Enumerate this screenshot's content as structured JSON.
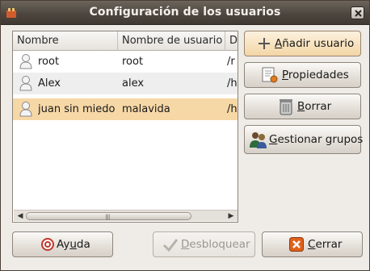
{
  "window": {
    "title": "Configuración de los usuarios",
    "app_icon": "users-admin-icon",
    "close_icon": "close-icon"
  },
  "table": {
    "columns": [
      "Nombre",
      "Nombre de usuario",
      "Di"
    ],
    "rows": [
      {
        "name": "root",
        "username": "root",
        "dir": "/r",
        "selected": false
      },
      {
        "name": "Alex",
        "username": "alex",
        "dir": "/h",
        "selected": false
      },
      {
        "name": "juan sin miedo",
        "username": "malavida",
        "dir": "/h",
        "selected": true
      }
    ],
    "row_icon": "user-icon"
  },
  "side_buttons": {
    "add": {
      "pre": "",
      "mnemonic": "A",
      "post": "ñadir usuario",
      "icon": "plus-icon"
    },
    "properties": {
      "pre": "",
      "mnemonic": "P",
      "post": "ropiedades",
      "icon": "properties-icon"
    },
    "delete": {
      "pre": "",
      "mnemonic": "B",
      "post": "orrar",
      "icon": "trash-icon"
    },
    "groups": {
      "pre": "",
      "mnemonic": "G",
      "post": "estionar grupos",
      "icon": "groups-icon"
    }
  },
  "bottom_buttons": {
    "help": {
      "pre": "Ay",
      "mnemonic": "u",
      "post": "da",
      "icon": "help-icon"
    },
    "unlock": {
      "pre": "",
      "mnemonic": "D",
      "post": "esbloquear",
      "icon": "checkmark-icon",
      "enabled": false
    },
    "close": {
      "pre": "",
      "mnemonic": "C",
      "post": "errar",
      "icon": "close-icon"
    }
  },
  "colors": {
    "titlebar": "#4e4740",
    "selection": "#f6d7a6",
    "window_bg": "#efebe7"
  }
}
